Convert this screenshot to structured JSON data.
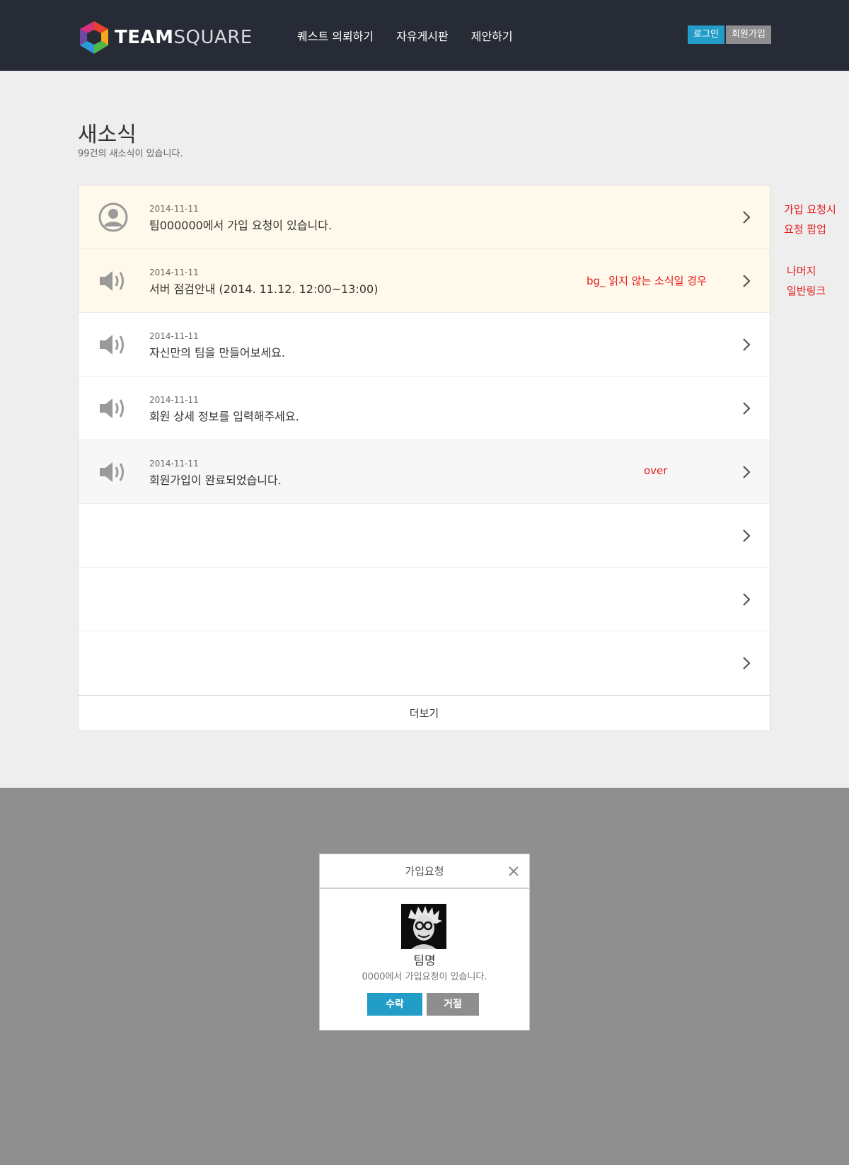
{
  "header": {
    "logo_bold": "TEAM",
    "logo_light": "SQUARE",
    "nav": [
      "퀘스트 의뢰하기",
      "자유게시판",
      "제안하기"
    ],
    "login": "로그인",
    "join": "회원가입"
  },
  "page": {
    "title": "새소식",
    "subtitle": "99건의 새소식이 있습니다."
  },
  "news": {
    "items": [
      {
        "date": "2014-11-11",
        "title": "팀000000에서 가입 요청이 있습니다.",
        "icon": "user-icon",
        "state": "unread"
      },
      {
        "date": "2014-11-11",
        "title": "서버 점검안내 (2014. 11.12. 12:00~13:00)",
        "icon": "speaker-icon",
        "state": "unread"
      },
      {
        "date": "2014-11-11",
        "title": "자신만의 팀을 만들어보세요.",
        "icon": "speaker-icon",
        "state": "read"
      },
      {
        "date": "2014-11-11",
        "title": "회원 상세 정보를 입력해주세요.",
        "icon": "speaker-icon",
        "state": "read"
      },
      {
        "date": "2014-11-11",
        "title": "회원가입이 완료되었습니다.",
        "icon": "speaker-icon",
        "state": "over"
      }
    ],
    "more": "더보기"
  },
  "annotations": {
    "unread_bg": "bg_ 읽지 않는 소식일 경우",
    "over": "over",
    "join_popup_1": "가입 요청시",
    "join_popup_2": "요청 팝업",
    "rest_1": "나머지",
    "rest_2": "일반링크"
  },
  "modal": {
    "title": "가입요청",
    "team_name": "팀명",
    "message": "0000에서 가입요청이 있습니다.",
    "accept": "수락",
    "reject": "거절"
  },
  "colors": {
    "header_bg": "#262b36",
    "accent": "#229dc8",
    "unread_bg": "#fef9ea",
    "annotation": "#e51b1b",
    "overlay": "#8f8f8f"
  }
}
